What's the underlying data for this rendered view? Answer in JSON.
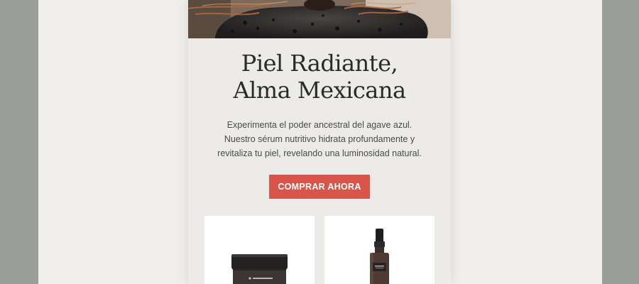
{
  "hero": {
    "image": "volcanic-stone-with-agave-fibers"
  },
  "headline": {
    "line1": "Piel Radiante,",
    "line2": "Alma Mexicana"
  },
  "description": {
    "line1": "Experimenta el poder ancestral del agave azul.",
    "line2": "Nuestro sérum nutritivo hidrata profundamente y",
    "line3": "revitaliza tu piel, revelando una luminosidad natural."
  },
  "cta": {
    "label": "COMPRAR AHORA"
  },
  "products": [
    {
      "image": "dark-cream-jar"
    },
    {
      "image": "amber-spray-bottle"
    }
  ],
  "colors": {
    "accent": "#d9554a",
    "card_background": "#ecebe7",
    "page_background": "#efeeea",
    "side_gray": "#9b9d98",
    "heading_text": "#2a2a2a"
  }
}
